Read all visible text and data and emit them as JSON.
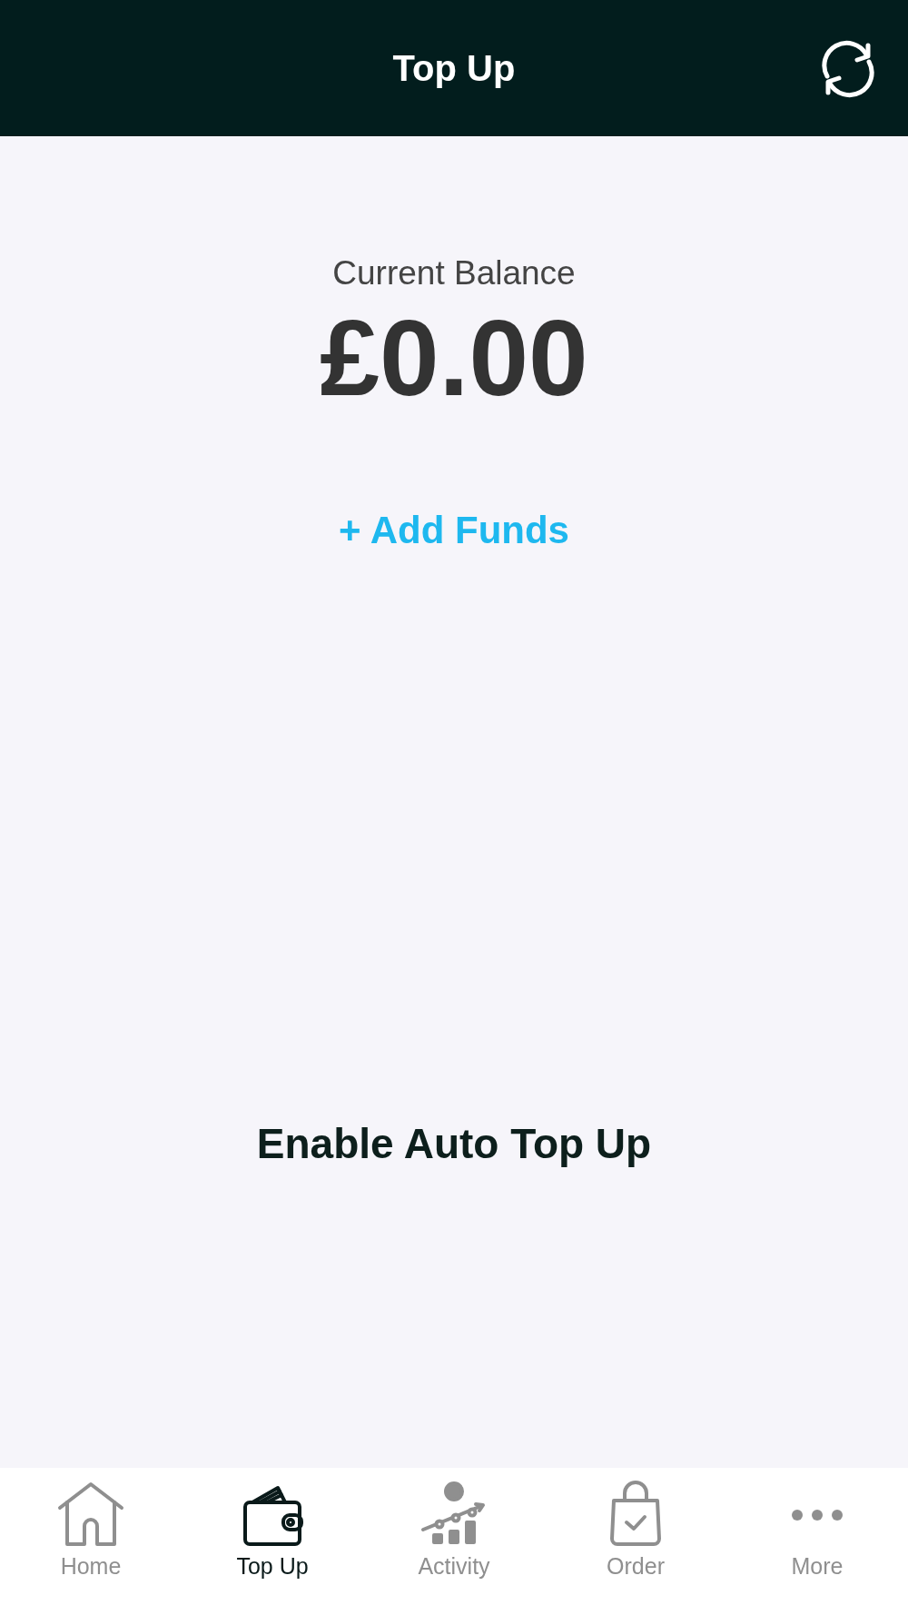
{
  "header": {
    "title": "Top Up"
  },
  "balance": {
    "label": "Current Balance",
    "amount": "£0.00",
    "add_funds": "+ Add Funds"
  },
  "auto_top_up": {
    "label": "Enable Auto Top Up"
  },
  "tab_bar": [
    {
      "label": "Home",
      "selected": false
    },
    {
      "label": "Top Up",
      "selected": true
    },
    {
      "label": "Activity",
      "selected": false
    },
    {
      "label": "Order",
      "selected": false
    },
    {
      "label": "More",
      "selected": false
    }
  ]
}
